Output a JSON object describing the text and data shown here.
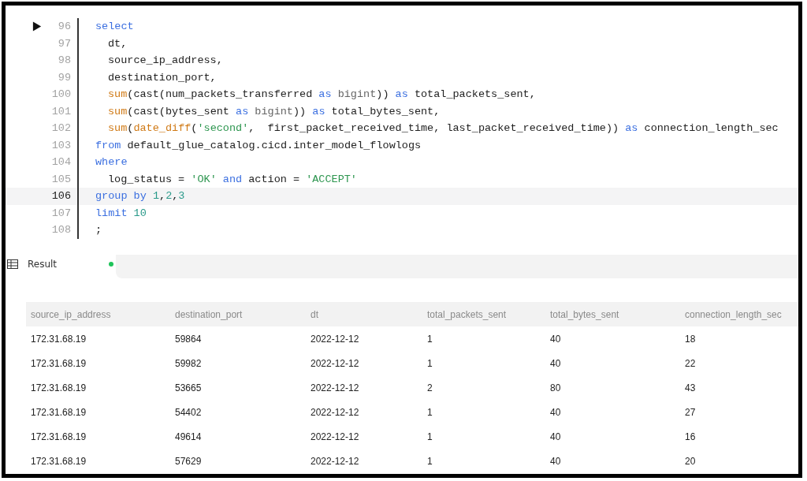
{
  "editor": {
    "lines": [
      {
        "number": "96",
        "runnable": true,
        "current": false,
        "indent": false,
        "tokens": [
          {
            "kind": "keyword",
            "text": "select"
          }
        ]
      },
      {
        "number": "97",
        "runnable": false,
        "current": false,
        "indent": true,
        "tokens": [
          {
            "kind": "plain",
            "text": "dt,"
          }
        ]
      },
      {
        "number": "98",
        "runnable": false,
        "current": false,
        "indent": true,
        "tokens": [
          {
            "kind": "plain",
            "text": "source_ip_address,"
          }
        ]
      },
      {
        "number": "99",
        "runnable": false,
        "current": false,
        "indent": true,
        "tokens": [
          {
            "kind": "plain",
            "text": "destination_port,"
          }
        ]
      },
      {
        "number": "100",
        "runnable": false,
        "current": false,
        "indent": true,
        "tokens": [
          {
            "kind": "function",
            "text": "sum"
          },
          {
            "kind": "plain",
            "text": "(cast(num_packets_transferred "
          },
          {
            "kind": "keyword",
            "text": "as"
          },
          {
            "kind": "type",
            "text": " bigint"
          },
          {
            "kind": "plain",
            "text": ")) "
          },
          {
            "kind": "keyword",
            "text": "as"
          },
          {
            "kind": "plain",
            "text": " total_packets_sent,"
          }
        ]
      },
      {
        "number": "101",
        "runnable": false,
        "current": false,
        "indent": true,
        "tokens": [
          {
            "kind": "function",
            "text": "sum"
          },
          {
            "kind": "plain",
            "text": "(cast(bytes_sent "
          },
          {
            "kind": "keyword",
            "text": "as"
          },
          {
            "kind": "type",
            "text": " bigint"
          },
          {
            "kind": "plain",
            "text": ")) "
          },
          {
            "kind": "keyword",
            "text": "as"
          },
          {
            "kind": "plain",
            "text": " total_bytes_sent,"
          }
        ]
      },
      {
        "number": "102",
        "runnable": false,
        "current": false,
        "indent": true,
        "tokens": [
          {
            "kind": "function",
            "text": "sum"
          },
          {
            "kind": "plain",
            "text": "("
          },
          {
            "kind": "function",
            "text": "date_diff"
          },
          {
            "kind": "plain",
            "text": "("
          },
          {
            "kind": "string",
            "text": "'second'"
          },
          {
            "kind": "plain",
            "text": ",  first_packet_received_time, last_packet_received_time)) "
          },
          {
            "kind": "keyword",
            "text": "as"
          },
          {
            "kind": "plain",
            "text": " connection_length_sec"
          }
        ]
      },
      {
        "number": "103",
        "runnable": false,
        "current": false,
        "indent": false,
        "tokens": [
          {
            "kind": "keyword",
            "text": "from"
          },
          {
            "kind": "plain",
            "text": " default_glue_catalog.cicd.inter_model_flowlogs"
          }
        ]
      },
      {
        "number": "104",
        "runnable": false,
        "current": false,
        "indent": false,
        "tokens": [
          {
            "kind": "keyword",
            "text": "where"
          }
        ]
      },
      {
        "number": "105",
        "runnable": false,
        "current": false,
        "indent": true,
        "tokens": [
          {
            "kind": "plain",
            "text": "log_status = "
          },
          {
            "kind": "string",
            "text": "'OK'"
          },
          {
            "kind": "keyword",
            "text": " and"
          },
          {
            "kind": "plain",
            "text": " action = "
          },
          {
            "kind": "string",
            "text": "'ACCEPT'"
          }
        ]
      },
      {
        "number": "106",
        "runnable": false,
        "current": true,
        "indent": false,
        "tokens": [
          {
            "kind": "keyword",
            "text": "group by "
          },
          {
            "kind": "number",
            "text": "1"
          },
          {
            "kind": "plain",
            "text": ","
          },
          {
            "kind": "number",
            "text": "2"
          },
          {
            "kind": "plain",
            "text": ","
          },
          {
            "kind": "number",
            "text": "3"
          }
        ]
      },
      {
        "number": "107",
        "runnable": false,
        "current": false,
        "indent": false,
        "tokens": [
          {
            "kind": "keyword",
            "text": "limit "
          },
          {
            "kind": "number",
            "text": "10"
          }
        ]
      },
      {
        "number": "108",
        "runnable": false,
        "current": false,
        "indent": false,
        "tokens": [
          {
            "kind": "plain",
            "text": ";"
          }
        ]
      }
    ]
  },
  "result_tabs": [
    {
      "label": "Result",
      "selected": true
    }
  ],
  "table": {
    "columns": [
      "source_ip_address",
      "destination_port",
      "dt",
      "total_packets_sent",
      "total_bytes_sent",
      "connection_length_sec"
    ],
    "rows": [
      [
        "172.31.68.19",
        "59864",
        "2022-12-12",
        "1",
        "40",
        "18"
      ],
      [
        "172.31.68.19",
        "59982",
        "2022-12-12",
        "1",
        "40",
        "22"
      ],
      [
        "172.31.68.19",
        "53665",
        "2022-12-12",
        "2",
        "80",
        "43"
      ],
      [
        "172.31.68.19",
        "54402",
        "2022-12-12",
        "1",
        "40",
        "27"
      ],
      [
        "172.31.68.19",
        "49614",
        "2022-12-12",
        "1",
        "40",
        "16"
      ],
      [
        "172.31.68.19",
        "57629",
        "2022-12-12",
        "1",
        "40",
        "20"
      ]
    ]
  }
}
